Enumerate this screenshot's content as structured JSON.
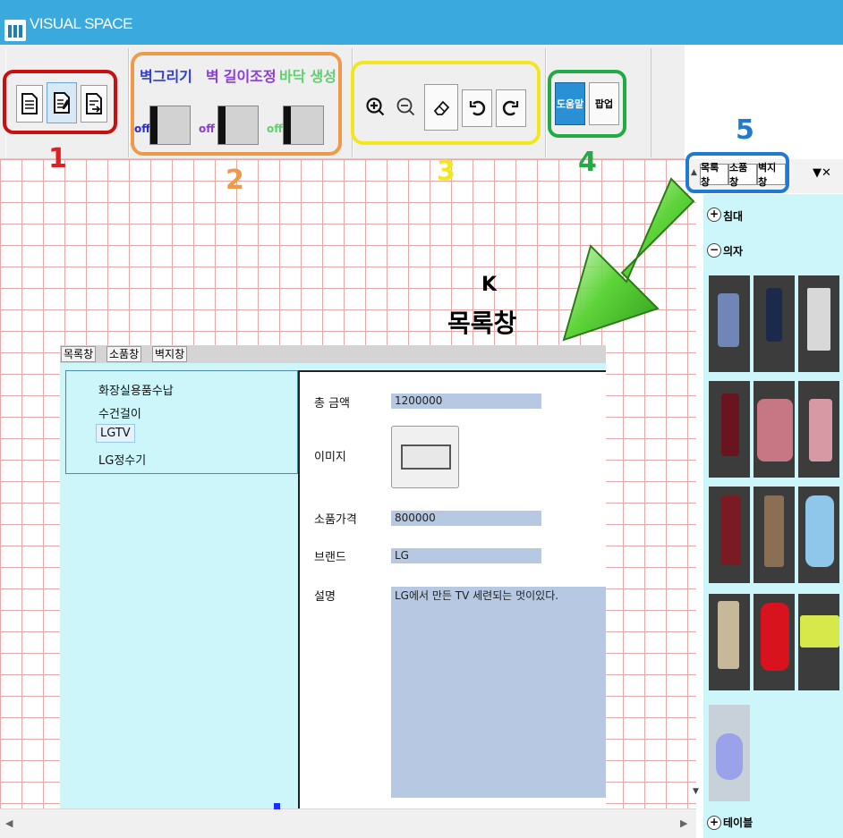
{
  "app": {
    "title": "VISUAL SPACE"
  },
  "ribbon": {
    "group2": {
      "draw_wall": "벽그리기",
      "adjust_wall": "벽 길이조정",
      "floor_create": "바닥 생성",
      "off1": "off",
      "off2": "off",
      "off3": "off"
    },
    "group4": {
      "help": "도움말",
      "popup": "팝업"
    }
  },
  "annotations": {
    "n1": "1",
    "n2": "2",
    "n3": "3",
    "n4": "4",
    "n5": "5",
    "k_line1": "K",
    "k_line2": "목록창"
  },
  "right_panel": {
    "tabs": [
      "목록창",
      "소품창",
      "벽지창"
    ],
    "controls": "▼✕",
    "categories": {
      "bed": "침대",
      "chair": "의자",
      "table": "테이블"
    },
    "plus": "+",
    "minus": "−"
  },
  "dialog": {
    "tabs": [
      "목록창",
      "소품창",
      "벽지창"
    ],
    "list": [
      "화장실용품수납",
      "수건걸이",
      "LGTV",
      "LG정수기"
    ],
    "labels": {
      "total": "총 금액",
      "image": "이미지",
      "price": "소품가격",
      "brand": "브랜드",
      "desc": "설명"
    },
    "values": {
      "total": "1200000",
      "price": "800000",
      "brand": "LG",
      "desc": "LG에서 만든 TV 세련되는 멋이있다."
    }
  },
  "colors": {
    "titlebar": "#3aa9dd",
    "grid": "#e9a8a8",
    "panel": "#cdf6fa",
    "field": "#b6c8e2",
    "n1": "#e02020",
    "n2": "#ef9a4a",
    "n3": "#f2e61c",
    "n4": "#22aa44",
    "n5": "#1f7bd0"
  }
}
